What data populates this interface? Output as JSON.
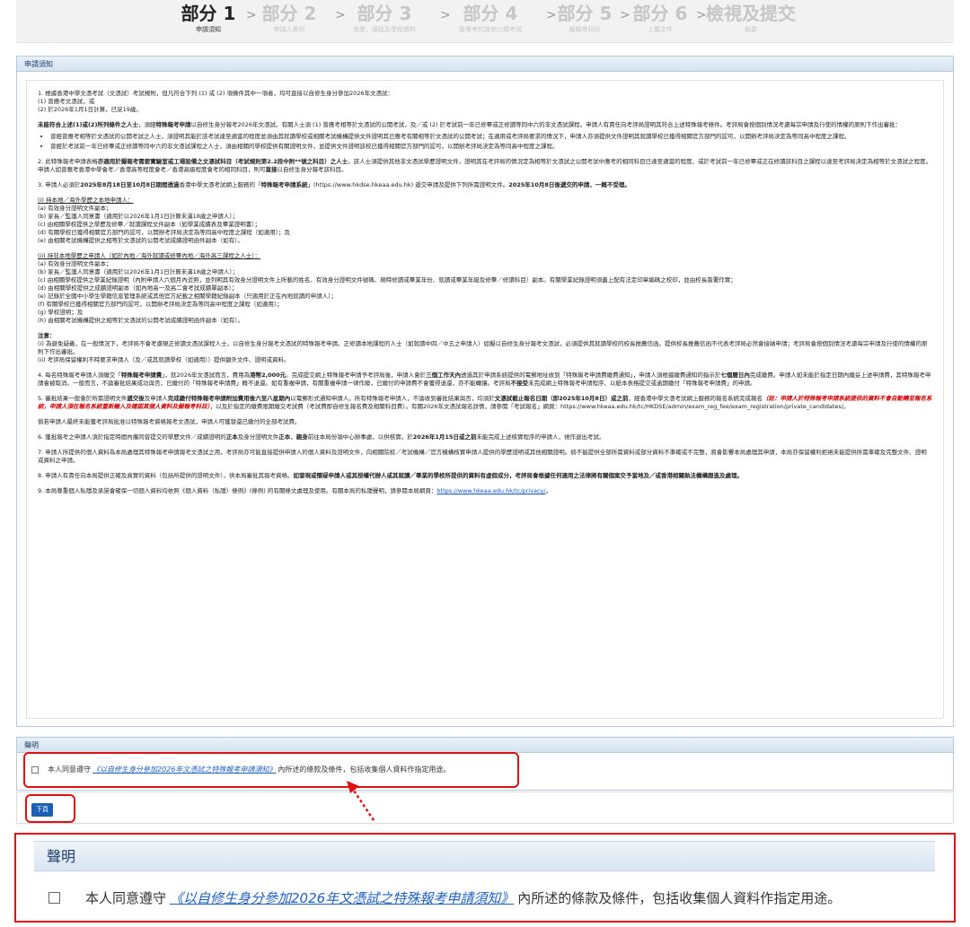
{
  "steps": [
    {
      "label": "部分 1",
      "sub": "申請須知",
      "active": true
    },
    {
      "label": "部分 2",
      "sub": "申請人資料",
      "active": false
    },
    {
      "label": "部分 3",
      "sub": "學歷、課程及學校資料",
      "active": false
    },
    {
      "label": "部分 4",
      "sub": "曾應考的其他公開考試",
      "active": false
    },
    {
      "label": "部分 5",
      "sub": "擬報考科目",
      "active": false
    },
    {
      "label": "部分 6",
      "sub": "上載文件",
      "active": false
    },
    {
      "label": "檢視及提交",
      "sub": "概要",
      "active": false
    }
  ],
  "step_arrow": ">",
  "notice": {
    "title": "申請須知",
    "p1": {
      "intro": "1. 根據香港中學文憑考試（文憑試）考試規則，但凡符合下列 (1) 或 (2) 項條件其中一項者，均可直接以自修生身分參加2026年文憑試：",
      "l1": "(1) 曾應考文憑試，或",
      "l2": "(2) 於2026年1月1日計算，已足19歲。"
    },
    "p_special": {
      "bold1": "未能符合上述(1)或(2)所列條件之人士",
      "t1": "，須經",
      "bold2": "特殊報考申請",
      "t2": "以自修生身分報考2026年文憑試。有關人士須 (1) 曾應考相等於文憑試的公開考試，及／或 (2) 於考試前一年已修畢或正修讀等同中六的非文憑試課程。申請人有責任向考評局證明其符合上述特殊報考條件。考評局會按個別情況考慮每宗申請及行使的情權的原則下作出審批：",
      "b1": "曾經曾應考相等於文憑試的公開考試之人士，須證明其能於該考試達至適當的程度並須由其就讀學校或相關考試機構提供文件證明其已應考有關相等於文憑試的公開考試；在適用或考評局要求的情況下，申請人亦須提供文件證明其就讀學校已獲得相關官方部門的認可，以開辦考評局決定為等同高中程度之課程。",
      "b2": "曾經於考試前一年已修畢或正修讀等同中六的非文憑試課程之人士，須由相關的學校提供有關證明文件，並提供文件證明該校已獲得相關官方部門的認可，以開辦考評局決定為等同高中程度之課程。"
    },
    "p2": {
      "t1": "2. 此特殊報考申請表格",
      "bold1": "亦適用於擬報考需要實驗室或工場設備之文憑試科目（考試規則第2.2段中附**號之科目）之人士",
      "t2": "。該人士須提供其他非文憑試學歷證明文件，證明其在考評局的情況定為相等於文憑試之公開考試中應考的相同科目已達至適當的程度、或於考試前一年已修畢或正在修讀該科目之課程以達至考評局決定為相等於文憑試之程度。申請人如曾應考香港中學會考／香港高等程度會考／香港高級程度會考的相同科目，則可",
      "bold2": "直接",
      "t3": "以自修生身分報考該科目。"
    },
    "p3": {
      "t1": "3. 申請人必須於",
      "bold1": "2025年8月18日至10月8日期間透過",
      "t2": "香港中學文憑考試網上服務的「",
      "bold2": "特殊報考申請系統",
      "t3": "」(https://www.hkdse.hkeaa.edu.hk) 遞交申請及提供下列所需證明文件。",
      "bold3": "2025年10月8日後遞交的申請，一概不受理。"
    },
    "local": {
      "head": "(i)   持本地／海外學歷之本地申請人：",
      "items": [
        "(a)  有效身分證明文件副本；",
        "(b)  家長／監護人同意書（適用於以2026年1月1日計算未滿18歲之申請人）；",
        "(c)  由相關學校提供之學歷及修畢／就讀課程文件副本（如學業成績表及畢業證明書）；",
        "(d)  有關學校已獲得相關官方部門的認可，以開辦考評局決定為等同高中程度之課程（如適用）；及",
        "(e)   由相關考試機構提供之相等於文憑試的公開考試成績證明函件副本（如有）。"
      ]
    },
    "nonlocal": {
      "head": "(ii)  持非本地學歷之申請人（如於內地／海外就讀或修畢內地／海外高三課程之人士）：",
      "items": [
        "(a)  有效身分證明文件副本；",
        "(b)  家長／監護人同意書（適用於以2026年1月1日計算未滿18歲之申請人）；",
        "(c)  由相關學校提供之學業紀錄證明（內附申請人六個月內近照，並列明其有效身分證明文件上所載的姓名、有效身分證明文件號碼、現時修讀或畢業年份、就讀或畢業年級及修畢／修讀科目）副本。有關學業紀錄證明須蓋上配有法定印章編碼之校印，並由校長簽署作實；",
        "(d)  由相關學校提供之成績證明副本（如內地高一及高二會考試成績單副本）；",
        "(e)  記錄於全國中小學生學籍信息管理系統或其他官方紀載之相關學籍紀錄副本（只適用於正在內地就讀的申請人）；",
        "(f)   有關學校已獲得相關官方部門的認可，以開辦考評局決定為等同高中程度之課程（如適用）；",
        "(g)  學校證明；及",
        "(h)  由相關考試機構提供之相等於文憑試的公開考試成績證明函件副本（如有）。"
      ]
    },
    "note": {
      "head": "注意：",
      "n1": "(i)   為避免疑義，在一般情況下，考評局不會考慮現正修讀文憑試課程人士，以自修生身分報考文憑試的特殊報考申請。正修讀本地課程的人士（如就讀中四／中五之申請人）如擬以自修生身分報考文憑試，必須提供其就讀學校的校長推薦信函。提供校長推薦信函不代表考評局必然會接納申請；考評局會按個別情況考慮每宗申請及行使的情權的原則下作出審批。",
      "n2": "(ii)  考評局保留權利不時要求申請人（及／或其就讀學校（如適用））提供額外文件、證明或資料。"
    },
    "p4": {
      "t1": "4. 每名特殊報考申請人須繳交「",
      "bold1": "特殊報考申請費",
      "t2": "」，就2026年文憑試而言，費用為",
      "bold2": "港幣2,000元",
      "t3": "。完成提交網上特殊報考申請予考評局後，申請人會於",
      "bold3": "三個工作天內",
      "t4": "透過其於申請系統提供的電郵地址收到「特殊報考申請費繳費通知」，申請人須根據繳費通知的指示於",
      "bold4": "七個曆日內",
      "t5": "完成繳費。申請人如未能於指定日期內繳妥上述申請費，其特殊報考申請會被取消。一般而言，不論審批結果成功與否，已繳付的「特殊報考申請費」概不退還。如有重複申請，有關重複申請一律作廢，已繳付的申請費不會獲得退還，亦不能轉讓。考評局",
      "bold5": "不接受",
      "t6": "未完成網上特殊報考申請程序、以紙本表格提交或逾期繳付「特殊報考申請費」的申請。"
    },
    "p5": {
      "t1": "5. 審批結果一般會於所需證明文件",
      "bold1": "遞交後",
      "t2": "及申請人",
      "bold2": "完成繳付特殊報考申請附加費用後六至八星期內",
      "t3": "以電郵形式通知申請人。所有特殊報考申請人，不論收到審批結果與否，均須於",
      "bold3": "文憑試截止報名日期（即2025年10月8日）或之前",
      "t4": "，經香港中學文憑考試網上服務的報名系統完成報名",
      "red": "（註：申請人於特殊報考申請系統提供的資料不會自動轉至報名系統，申請人須在報名系統重新輸入及確認其個人資料及擬報考科目）",
      "t5": "，以及於指定的繳費限期繳交考試費（考試費即自修生報名費及相關科目費）。有關2026年文憑試報名詳情，請參閱「考試報名」網頁：https://www.hkeaa.edu.hk/tc/HKDSE/admin/exam_reg_fee/exam_registration/private_candidates/。"
    },
    "p_refund": "倘若申請人最終未能獲考評局批准以特殊報考資格報考文憑試，申請人可獲發還已繳付的全部考試費。",
    "p6": {
      "t1": "6. 獲批報考之申請人須於指定時間內攜同曾提交的學歷文件／成績證明的",
      "bold1": "正本",
      "t2": "及身分證明文件",
      "bold2": "正本",
      "t3": "，",
      "bold3": "親身",
      "t4": "前往本局份領中心辦事處，以供核實。於",
      "bold4": "2026年1月15日或之前",
      "t5": "未能完成上述核實程序的申請人，視作退出考試。"
    },
    "p7": "7. 申請人所提供的個人資料為本局處理其特殊報考申請報考文憑試之用，考評局亦可能直接提供申請人的個人資料及證明文件，向相關院校／考試機構／官方機構核實申請人提供的學歷證明或其他相關證明。倘不能提供全部所需資料或部分資料不準確或不完整，將會影響本局處理其申請，本局亦保留權利拒絕未能提供所需準確及完整文件、證明或資料之申請。",
    "p8": {
      "t1": "8. 申請人有責任向本局提供正確及真實的資料（包括所提供的證明文件），供本局審批其報考資格。",
      "bold1": "如發現或懷疑申請人或其授權代辦人或其就讀／畢業的學校所提供的資料有虛假成分，考評局會根據任何適用之法律將有關個案交予當地及／或香港相關執法機構跟進及處理。"
    },
    "p9": {
      "t1": "9. 本局尊重個人私隱及承諾會確保一切個人資料均依照《個人資料（私隱）條例》(條例) 的有關條文處理及使用。有關本局的私隱聲明，請參閱本局網頁：",
      "link": "https://www.hkeaa.edu.hk/tc/privacy/",
      "t2": "。"
    }
  },
  "declaration": {
    "title": "聲明",
    "pre": "本人同意遵守",
    "link": "《以自修生身分參加2026年文憑試之特殊報考申請須知》",
    "post": "內所述的條款及條件，包括收集個人資料作指定用途。",
    "checked": false
  },
  "next_button": "下頁",
  "zoom": {
    "title": "聲明",
    "pre": "本人同意遵守",
    "link": "《以自修生身分參加2026年文憑試之特殊報考申請須知》",
    "post": "內所述的條款及條件，包括收集個人資料作指定用途。"
  },
  "colors": {
    "highlight": "#e01010",
    "link": "#1f5fbf",
    "button": "#1a5fb4",
    "panel_header": "#d6e3f1"
  }
}
